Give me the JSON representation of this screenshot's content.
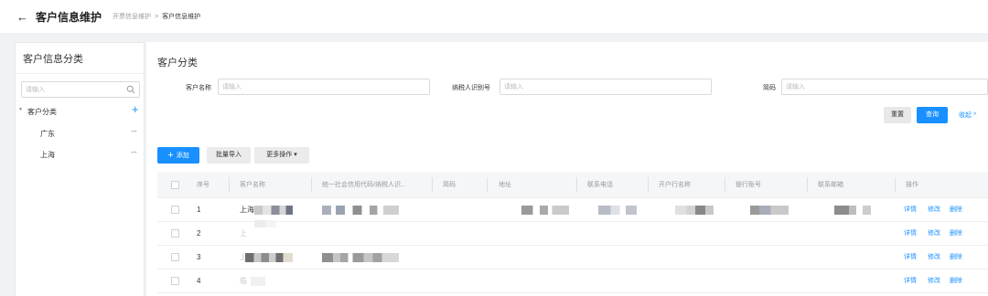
{
  "header": {
    "back_glyph": "←",
    "title": "客户信息维护",
    "breadcrumb": [
      "开票信息维护",
      "客户信息维护"
    ],
    "breadcrumb_sep": ">"
  },
  "sidebar": {
    "title": "客户信息分类",
    "search_placeholder": "请输入",
    "tree": {
      "root_label": "客户分类",
      "add_glyph": "+",
      "children": [
        {
          "label": "广东",
          "more": "···"
        },
        {
          "label": "上海",
          "more": "···"
        }
      ]
    }
  },
  "main": {
    "title": "客户分类",
    "filters": {
      "name_label": "客户名称",
      "name_placeholder": "请输入",
      "taxid_label": "纳税人识别号",
      "taxid_placeholder": "请输入",
      "short_label": "简码",
      "short_placeholder": "请输入"
    },
    "actions": {
      "reset": "重置",
      "query": "查询",
      "collapse": "收起 ^"
    },
    "toolbar": {
      "add_icon": "+",
      "add": "添加",
      "import": "批量导入",
      "more": "更多操作 ▾"
    },
    "table": {
      "columns": [
        "序号",
        "客户名称",
        "统一社会信用代码/纳税人识...",
        "简码",
        "地址",
        "联系电话",
        "开户行名称",
        "银行账号",
        "联系邮箱",
        "操作"
      ],
      "rows": [
        {
          "no": "1",
          "name": "上海",
          "actions": [
            "详情",
            "修改",
            "删除"
          ]
        },
        {
          "no": "2",
          "name": "上",
          "actions": [
            "详情",
            "修改",
            "删除"
          ]
        },
        {
          "no": "3",
          "name": "上",
          "actions": [
            "详情",
            "修改",
            "删除"
          ]
        },
        {
          "no": "4",
          "name": "临",
          "actions": [
            "详情",
            "修改",
            "删除"
          ]
        }
      ]
    }
  },
  "colors": {
    "primary": "#1890ff",
    "background": "#f0f2f5"
  }
}
